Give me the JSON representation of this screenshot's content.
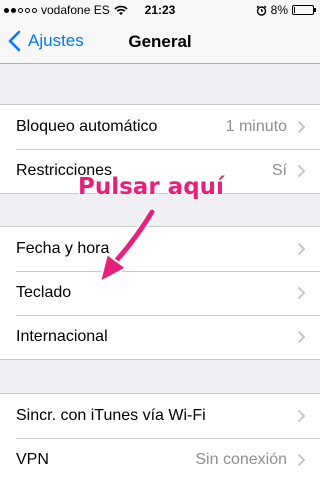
{
  "status_bar": {
    "carrier": "vodafone ES",
    "time": "21:23",
    "battery_percent": "8%",
    "battery_level": 0.08,
    "signal_bars_filled": 2,
    "signal_bars_total": 5,
    "icons": [
      "signal-icon",
      "wifi-icon",
      "alarm-icon",
      "battery-icon"
    ]
  },
  "nav": {
    "back_label": "Ajustes",
    "title": "General",
    "accent_color": "#007aff"
  },
  "groups": [
    {
      "rows": [
        {
          "label": "Bloqueo automático",
          "value": "1 minuto"
        },
        {
          "label": "Restricciones",
          "value": "Sí"
        }
      ]
    },
    {
      "rows": [
        {
          "label": "Fecha y hora",
          "value": ""
        },
        {
          "label": "Teclado",
          "value": ""
        },
        {
          "label": "Internacional",
          "value": ""
        }
      ]
    },
    {
      "rows": [
        {
          "label": "Sincr. con iTunes vía Wi-Fi",
          "value": ""
        },
        {
          "label": "VPN",
          "value": "Sin conexión"
        }
      ]
    }
  ],
  "annotation": {
    "text": "Pulsar aquí",
    "color": "#e8207a"
  }
}
